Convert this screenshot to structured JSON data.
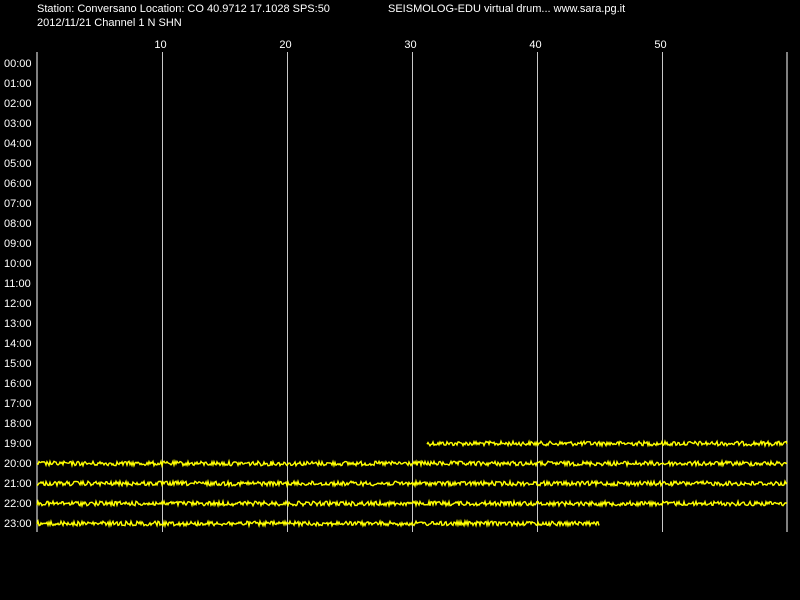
{
  "header": {
    "station_line": "Station: Conversano Location: CO 40.9712 17.1028 SPS:50",
    "product_line": "SEISMOLOG-EDU virtual drum... www.sara.pg.it",
    "date_line": "2012/11/21  Channel 1 N SHN"
  },
  "colors": {
    "background": "#000000",
    "grid": "#ffffff",
    "trace": "#ffff00",
    "text": "#ffffff"
  },
  "chart_data": {
    "type": "line",
    "title": "",
    "xlabel": "",
    "ylabel": "",
    "x_ticks": [
      "10",
      "20",
      "30",
      "40",
      "50"
    ],
    "x_tick_values": [
      10,
      20,
      30,
      40,
      50
    ],
    "xlim": [
      0,
      60
    ],
    "y_labels": [
      "00:00",
      "01:00",
      "02:00",
      "03:00",
      "04:00",
      "05:00",
      "06:00",
      "07:00",
      "08:00",
      "09:00",
      "10:00",
      "11:00",
      "12:00",
      "13:00",
      "14:00",
      "15:00",
      "16:00",
      "17:00",
      "18:00",
      "19:00",
      "20:00",
      "21:00",
      "22:00",
      "23:00"
    ],
    "grid": true,
    "traces": [
      {
        "hour": "19:00",
        "start_min": 31.2,
        "end_min": 60
      },
      {
        "hour": "20:00",
        "start_min": 0,
        "end_min": 60
      },
      {
        "hour": "21:00",
        "start_min": 0,
        "end_min": 60
      },
      {
        "hour": "22:00",
        "start_min": 0,
        "end_min": 60
      },
      {
        "hour": "23:00",
        "start_min": 0,
        "end_min": 45
      }
    ]
  }
}
